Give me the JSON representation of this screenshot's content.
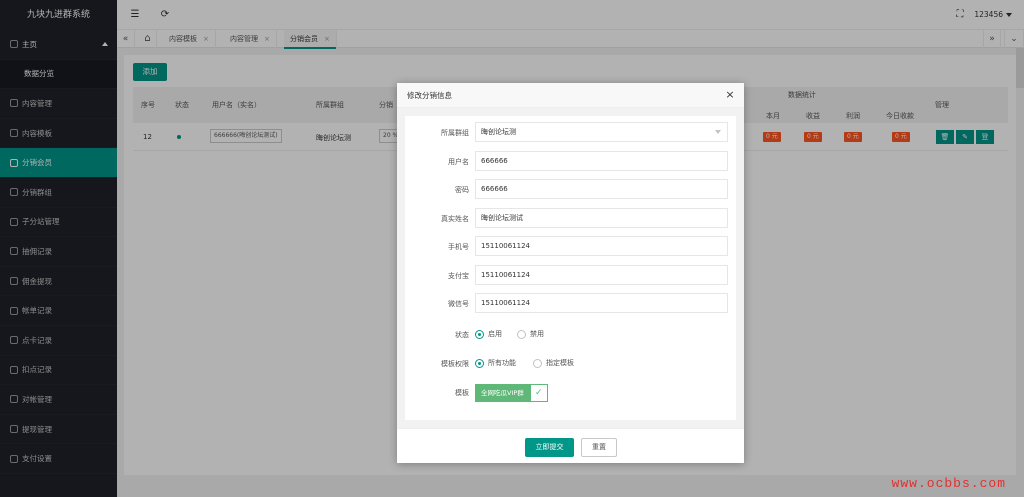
{
  "sidebar": {
    "logo": "九块九进群系统",
    "items": [
      {
        "label": "主页"
      },
      {
        "label": "数据分览"
      },
      {
        "label": "内容管理"
      },
      {
        "label": "内容模板"
      },
      {
        "label": "分销会员"
      },
      {
        "label": "分销群组"
      },
      {
        "label": "子分站管理"
      },
      {
        "label": "抽佣记录"
      },
      {
        "label": "佣金提现"
      },
      {
        "label": "帐单记录"
      },
      {
        "label": "点卡记录"
      },
      {
        "label": "扣点记录"
      },
      {
        "label": "对帐管理"
      },
      {
        "label": "提现管理"
      },
      {
        "label": "支付设置"
      }
    ]
  },
  "header": {
    "user": "123456",
    "menu_icon": "menu-fold-icon",
    "refresh_icon": "refresh-icon",
    "fullscreen_icon": "fullscreen-icon"
  },
  "tabs": {
    "items": [
      {
        "label": "内容模板"
      },
      {
        "label": "内容管理"
      },
      {
        "label": "分销会员"
      }
    ],
    "close": "×",
    "prev": "«",
    "next": "»"
  },
  "main": {
    "add_label": "添加",
    "columns": [
      "序号",
      "状态",
      "用户名（实名）",
      "所属群组",
      "分销"
    ],
    "stats_header": "数据统计",
    "stats_columns": [
      "本月",
      "收益",
      "利润",
      "今日收款"
    ],
    "manage_header": "管理",
    "row": {
      "id": "12",
      "username": "666666(晦创论坛测试)",
      "group": "晦创论坛测",
      "ratio": "20 %",
      "month": "0 元",
      "income": "0 元",
      "profit": "0 元",
      "today": "0 元",
      "action_3": "登"
    }
  },
  "modal": {
    "title": "修改分销信息",
    "close": "×",
    "fields": [
      {
        "label": "所属群组",
        "value": "晦创论坛测"
      },
      {
        "label": "用户名",
        "value": "666666"
      },
      {
        "label": "密码",
        "value": "666666"
      },
      {
        "label": "真实姓名",
        "value": "晦创论坛测试"
      },
      {
        "label": "手机号",
        "value": "15110061124"
      },
      {
        "label": "支付宝",
        "value": "15110061124"
      },
      {
        "label": "微信号",
        "value": "15110061124"
      }
    ],
    "status": {
      "label": "状态",
      "options": [
        "启用",
        "禁用"
      ],
      "selected": "启用"
    },
    "permission": {
      "label": "模板权限",
      "options": [
        "所有功能",
        "指定模板"
      ],
      "selected": "所有功能"
    },
    "template": {
      "label": "模板",
      "tag": "全网吃瓜VIP群"
    },
    "submit": "立即提交",
    "reset": "重置"
  },
  "watermark": "www.ocbbs.com",
  "colors": {
    "primary": "#009688",
    "sidebar": "#20222a",
    "danger": "#FF5722"
  }
}
